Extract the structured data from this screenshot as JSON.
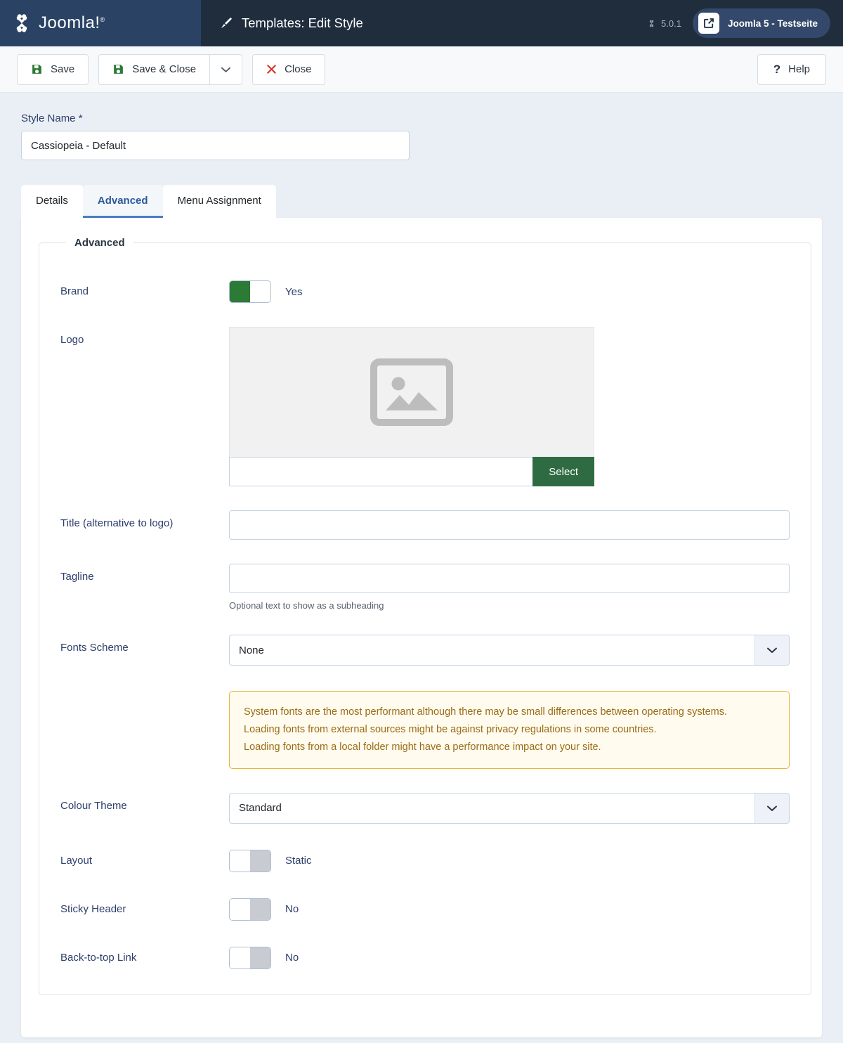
{
  "header": {
    "brand_name": "Joomla!",
    "brand_registered": "®",
    "page_title": "Templates: Edit Style",
    "page_title_icon": "paintbrush-icon",
    "version": "5.0.1",
    "version_icon": "joomla-icon",
    "site_name": "Joomla 5 - Testseite",
    "site_icon": "external-link-icon"
  },
  "toolbar": {
    "save_label": "Save",
    "save_close_label": "Save & Close",
    "save_close_caret_icon": "chevron-down-icon",
    "close_label": "Close",
    "close_icon": "x-icon",
    "save_icon": "floppy-disk-icon",
    "help_label": "Help",
    "help_icon": "question-mark-icon"
  },
  "form": {
    "style_name_label": "Style Name *",
    "style_name_value": "Cassiopeia - Default"
  },
  "tabs": [
    {
      "label": "Details",
      "active": false
    },
    {
      "label": "Advanced",
      "active": true
    },
    {
      "label": "Menu Assignment",
      "active": false
    }
  ],
  "advanced": {
    "legend": "Advanced",
    "brand": {
      "label": "Brand",
      "state": "on",
      "value_text": "Yes"
    },
    "logo": {
      "label": "Logo",
      "placeholder_icon": "image-placeholder-icon",
      "path_value": "",
      "select_label": "Select"
    },
    "title": {
      "label": "Title (alternative to logo)",
      "value": ""
    },
    "tagline": {
      "label": "Tagline",
      "value": "",
      "help": "Optional text to show as a subheading"
    },
    "fonts_scheme": {
      "label": "Fonts Scheme",
      "value": "None",
      "caret_icon": "chevron-down-icon"
    },
    "fonts_notice": {
      "line1": "System fonts are the most performant although there may be small differences between operating systems.",
      "line2": "Loading fonts from external sources might be against privacy regulations in some countries.",
      "line3": "Loading fonts from a local folder might have a performance impact on your site."
    },
    "colour_theme": {
      "label": "Colour Theme",
      "value": "Standard",
      "caret_icon": "chevron-down-icon"
    },
    "layout": {
      "label": "Layout",
      "state": "off",
      "value_text": "Static"
    },
    "sticky_header": {
      "label": "Sticky Header",
      "state": "off",
      "value_text": "No"
    },
    "back_to_top": {
      "label": "Back-to-top Link",
      "state": "off",
      "value_text": "No"
    }
  },
  "colors": {
    "header_logo_bg": "#2a4365",
    "header_main_bg": "#1f2d3d",
    "page_bg": "#eaeff5",
    "accent_green": "#2b7a35",
    "select_green": "#2f6b42",
    "close_red": "#d9342b",
    "tab_active": "#2a5a9c",
    "alert_border": "#e8b53c",
    "alert_bg": "#fffbef",
    "alert_text": "#9c6b12"
  }
}
